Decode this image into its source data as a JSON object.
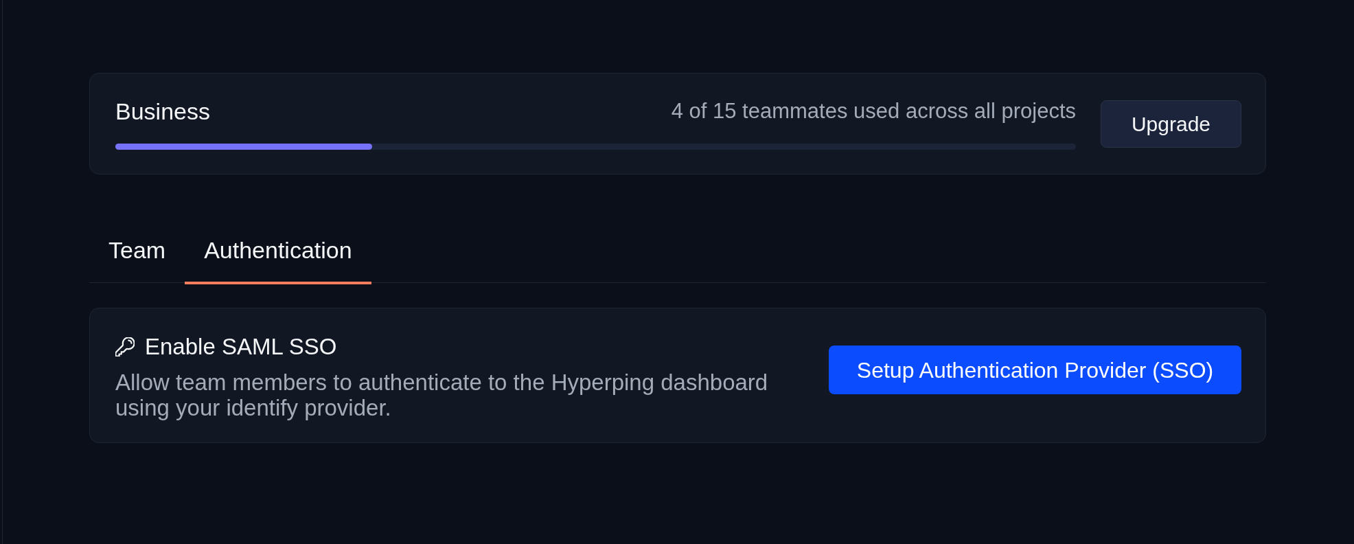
{
  "plan": {
    "name": "Business",
    "usage": "4 of 15 teammates used across all projects",
    "level": 0.267,
    "button": "Upgrade"
  },
  "tabs": [
    {
      "label": "Team",
      "selected": false
    },
    {
      "label": "Authentication",
      "selected": true
    }
  ],
  "sso_card": {
    "title": "Enable SAML SSO",
    "description": "Allow team members to authenticate to the Hyperping dashboard using your identify provider.",
    "button": "Setup Authentication Provider (SSO)"
  }
}
